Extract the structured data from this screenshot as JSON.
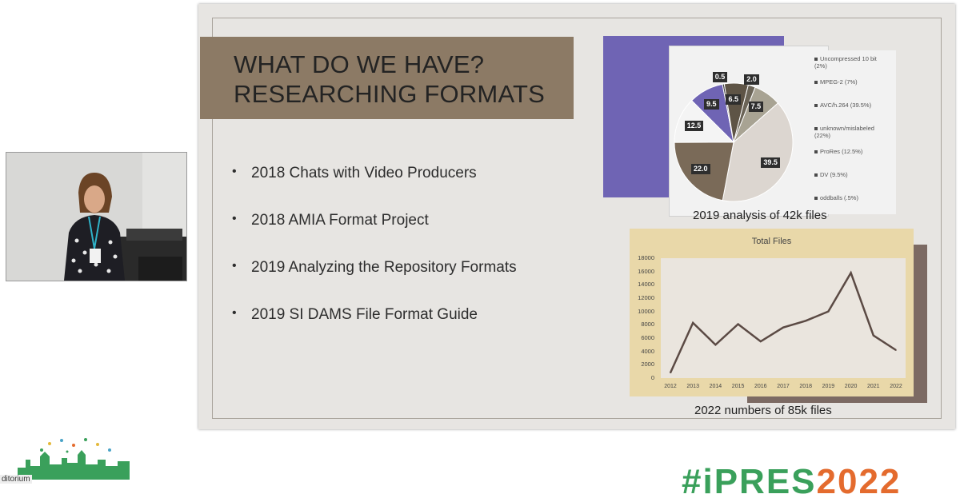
{
  "slide": {
    "title_line1": "WHAT DO WE HAVE?",
    "title_line2": "RESEARCHING FORMATS",
    "bullets": [
      "2018 Chats with Video Producers",
      "2018 AMIA Format Project",
      "2019 Analyzing the Repository Formats",
      "2019 SI DAMS File Format Guide"
    ],
    "pie_caption": "2019 analysis of 42k files",
    "line_caption": "2022 numbers of 85k files"
  },
  "chart_data": [
    {
      "type": "pie",
      "categories": [
        "Uncompressed 10 bit (2%)",
        "MPEG-2 (7%)",
        "AVC/h.264 (39.5%)",
        "unknown/mislabeled (22%)",
        "ProRes (12.5%)",
        "DV (9.5%)",
        "oddballs (.5%)"
      ],
      "values": [
        2.0,
        7.5,
        39.5,
        22.0,
        12.5,
        9.5,
        0.5,
        6.5
      ],
      "labels": [
        "2.0",
        "7.5",
        "39.5",
        "22.0",
        "12.5",
        "9.5",
        "0.5",
        "6.5"
      ],
      "colors": [
        "#6b6457",
        "#a8a393",
        "#dcd6d0",
        "#7a6a58",
        "#f4f4f4",
        "#6f64b4",
        "#3c3c3c",
        "#5e5446"
      ]
    },
    {
      "type": "line",
      "title": "Total Files",
      "x": [
        "2012",
        "2013",
        "2014",
        "2015",
        "2016",
        "2017",
        "2018",
        "2019",
        "2020",
        "2021",
        "2022"
      ],
      "values": [
        800,
        8300,
        5000,
        8100,
        5500,
        7600,
        8600,
        10000,
        15800,
        6400,
        4200
      ],
      "ylim": [
        0,
        18000
      ],
      "yticks": [
        "18000",
        "16000",
        "14000",
        "12000",
        "10000",
        "8000",
        "6000",
        "4000",
        "2000",
        "0"
      ],
      "line_color": "#5b4a44"
    }
  ],
  "footer": {
    "room_label": "ditorium",
    "conf_prefix": "#iPRES",
    "conf_year": "2022"
  }
}
